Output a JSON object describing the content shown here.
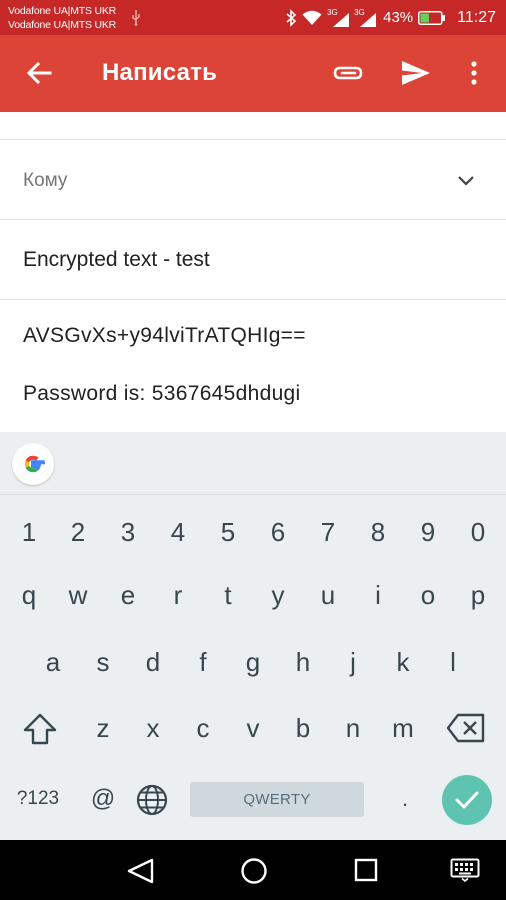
{
  "status_bar": {
    "carrier_line1": "Vodafone UA|MTS UKR",
    "carrier_line2": "Vodafone UA|MTS UKR",
    "net1": "3G",
    "net2": "3G",
    "battery_percent": "43%",
    "time": "11:27",
    "battery_level": 0.43
  },
  "app_bar": {
    "title": "Написать",
    "color": "#dc4437"
  },
  "compose": {
    "to_label": "Кому",
    "subject": "Encrypted text - test",
    "body_line1": "AVSGvXs+y94lviTrATQHIg==",
    "body_line2": "Password is: 5367645dhdugi"
  },
  "keyboard": {
    "row_numbers": [
      "1",
      "2",
      "3",
      "4",
      "5",
      "6",
      "7",
      "8",
      "9",
      "0"
    ],
    "row_q": [
      "q",
      "w",
      "e",
      "r",
      "t",
      "y",
      "u",
      "i",
      "o",
      "p"
    ],
    "row_a": [
      "a",
      "s",
      "d",
      "f",
      "g",
      "h",
      "j",
      "k",
      "l"
    ],
    "row_z": [
      "z",
      "x",
      "c",
      "v",
      "b",
      "n",
      "m"
    ],
    "symbols_label": "?123",
    "at_label": "@",
    "space_label": "QWERTY",
    "period_label": ".",
    "enter_color": "#5ec3b0"
  }
}
